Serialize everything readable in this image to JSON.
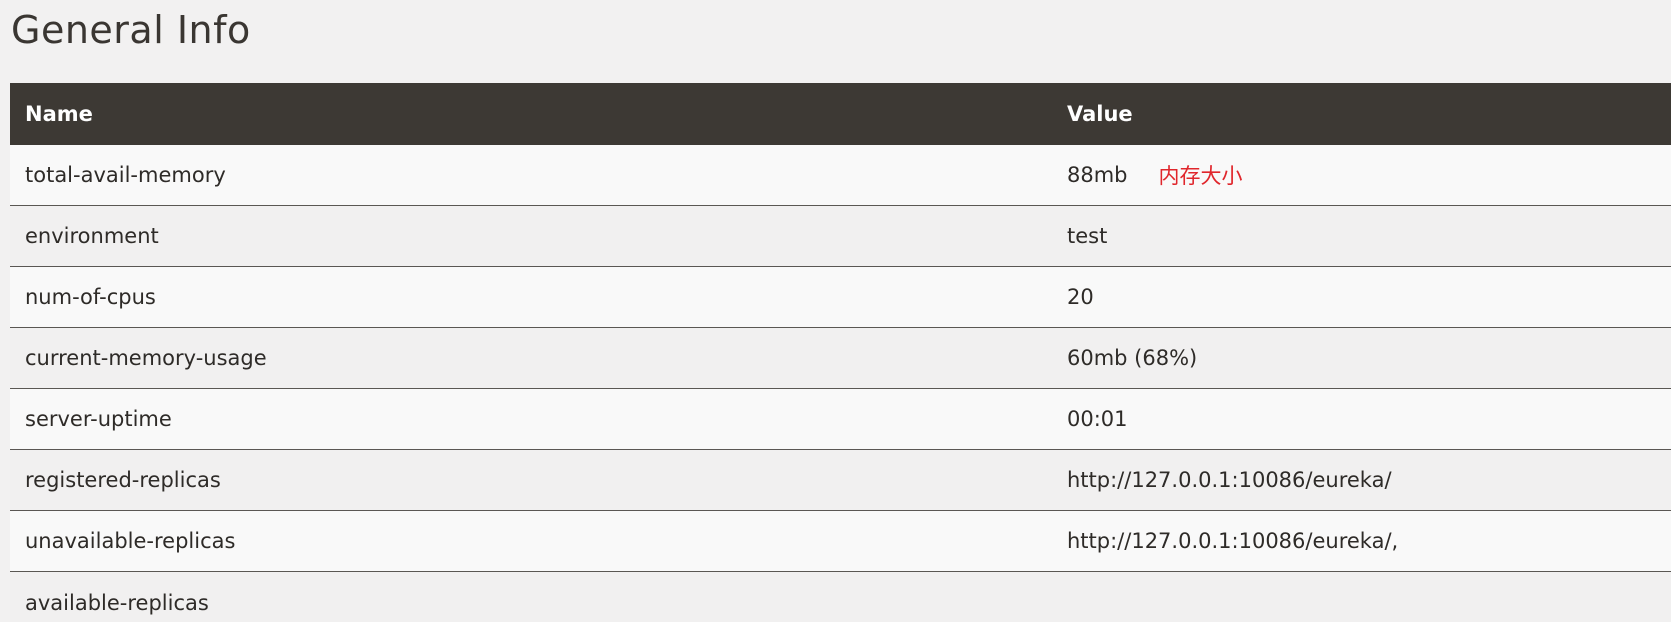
{
  "section": {
    "title": "General Info"
  },
  "table": {
    "headers": {
      "name": "Name",
      "value": "Value"
    },
    "rows": [
      {
        "name": "total-avail-memory",
        "value": "88mb",
        "note": "内存大小"
      },
      {
        "name": "environment",
        "value": "test"
      },
      {
        "name": "num-of-cpus",
        "value": "20"
      },
      {
        "name": "current-memory-usage",
        "value": "60mb (68%)"
      },
      {
        "name": "server-uptime",
        "value": "00:01"
      },
      {
        "name": "registered-replicas",
        "value": "http://127.0.0.1:10086/eureka/"
      },
      {
        "name": "unavailable-replicas",
        "value": "http://127.0.0.1:10086/eureka/,"
      },
      {
        "name": "available-replicas",
        "value": ""
      }
    ]
  },
  "colors": {
    "header_bg": "#3d3934",
    "header_text": "#ffffff",
    "annotation": "#e0262c"
  }
}
